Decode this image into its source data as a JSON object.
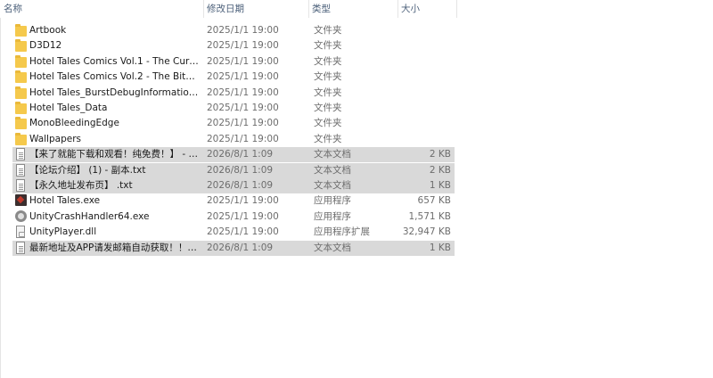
{
  "header": {
    "name": "名称",
    "date": "修改日期",
    "type": "类型",
    "size": "大小"
  },
  "files": [
    {
      "name": "Artbook",
      "date": "2025/1/1 19:00",
      "type": "文件夹",
      "size": "",
      "icon": "folder-icon",
      "selected": false
    },
    {
      "name": "D3D12",
      "date": "2025/1/1 19:00",
      "type": "文件夹",
      "size": "",
      "icon": "folder-icon",
      "selected": false
    },
    {
      "name": "Hotel Tales Comics Vol.1 - The Curse...",
      "date": "2025/1/1 19:00",
      "type": "文件夹",
      "size": "",
      "icon": "folder-icon",
      "selected": false
    },
    {
      "name": "Hotel Tales Comics Vol.2 - The Bite T...",
      "date": "2025/1/1 19:00",
      "type": "文件夹",
      "size": "",
      "icon": "folder-icon",
      "selected": false
    },
    {
      "name": "Hotel Tales_BurstDebugInformation_...",
      "date": "2025/1/1 19:00",
      "type": "文件夹",
      "size": "",
      "icon": "folder-icon",
      "selected": false
    },
    {
      "name": "Hotel Tales_Data",
      "date": "2025/1/1 19:00",
      "type": "文件夹",
      "size": "",
      "icon": "folder-icon",
      "selected": false
    },
    {
      "name": "MonoBleedingEdge",
      "date": "2025/1/1 19:00",
      "type": "文件夹",
      "size": "",
      "icon": "folder-icon",
      "selected": false
    },
    {
      "name": "Wallpapers",
      "date": "2025/1/1 19:00",
      "type": "文件夹",
      "size": "",
      "icon": "folder-icon",
      "selected": false
    },
    {
      "name": "【来了就能下载和观看！纯免费！】 - 副...",
      "date": "2026/8/1 1:09",
      "type": "文本文档",
      "size": "2 KB",
      "icon": "text-document-icon",
      "selected": true
    },
    {
      "name": "【论坛介绍】 (1) - 副本.txt",
      "date": "2026/8/1 1:09",
      "type": "文本文档",
      "size": "2 KB",
      "icon": "text-document-icon",
      "selected": true
    },
    {
      "name": "【永久地址发布页】 .txt",
      "date": "2026/8/1 1:09",
      "type": "文本文档",
      "size": "1 KB",
      "icon": "text-document-icon",
      "selected": true
    },
    {
      "name": "Hotel Tales.exe",
      "date": "2025/1/1 19:00",
      "type": "应用程序",
      "size": "657 KB",
      "icon": "hotel-tales-app-icon",
      "selected": false
    },
    {
      "name": "UnityCrashHandler64.exe",
      "date": "2025/1/1 19:00",
      "type": "应用程序",
      "size": "1,571 KB",
      "icon": "unity-app-icon",
      "selected": false
    },
    {
      "name": "UnityPlayer.dll",
      "date": "2025/1/1 19:00",
      "type": "应用程序扩展",
      "size": "32,947 KB",
      "icon": "dll-file-icon",
      "selected": false
    },
    {
      "name": "最新地址及APP请发邮箱自动获取！！！...",
      "date": "2026/8/1 1:09",
      "type": "文本文档",
      "size": "1 KB",
      "icon": "text-document-icon",
      "selected": true
    }
  ]
}
